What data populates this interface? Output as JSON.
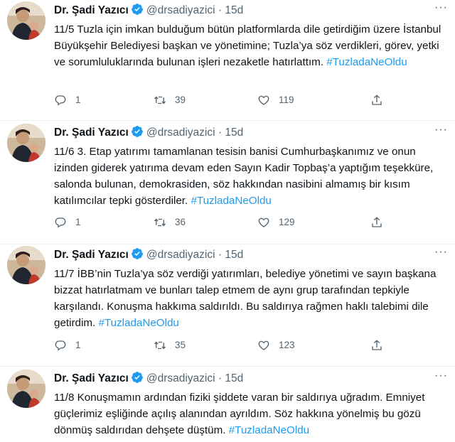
{
  "tweets": [
    {
      "name": "Dr. Şadi Yazıcı",
      "handle": "@drsadiyazici",
      "separator": "·",
      "time": "15d",
      "text": "11/5 Tuzla için imkan bulduğum bütün platformlarda dile getirdiğim üzere İstanbul Büyükşehir Belediyesi başkan ve yönetimine; Tuzla’ya söz verdikleri, görev, yetki ve sorumluluklarında bulunan işleri nezaketle hatırlattım. ",
      "hashtag": "#TuzladaNeOldu",
      "replies": "1",
      "retweets": "39",
      "likes": "119"
    },
    {
      "name": "Dr. Şadi Yazıcı",
      "handle": "@drsadiyazici",
      "separator": "·",
      "time": "15d",
      "text": "11/6 3. Etap yatırımı tamamlanan tesisin banisi Cumhurbaşkanımız ve onun izinden giderek yatırıma devam eden Sayın Kadir Topbaş’a yaptığım teşekküre, salonda bulunan, demokrasiden, söz hakkından nasibini almamış bir kısım katılımcılar tepki gösterdiler. ",
      "hashtag": "#TuzladaNeOldu",
      "replies": "1",
      "retweets": "36",
      "likes": "129"
    },
    {
      "name": "Dr. Şadi Yazıcı",
      "handle": "@drsadiyazici",
      "separator": "·",
      "time": "15d",
      "text": "11/7 İBB’nin Tuzla’ya söz verdiği yatırımları, belediye yönetimi ve sayın başkana bizzat hatırlatmam ve bunları talep etmem de aynı grup tarafından tepkiyle karşılandı. Konuşma hakkıma saldırıldı. Bu saldırıya rağmen haklı talebimi dile getirdim. ",
      "hashtag": "#TuzladaNeOldu",
      "replies": "1",
      "retweets": "35",
      "likes": "123"
    },
    {
      "name": "Dr. Şadi Yazıcı",
      "handle": "@drsadiyazici",
      "separator": "·",
      "time": "15d",
      "text": "11/8 Konuşmamın ardından fiziki şiddete varan bir saldırıya uğradım. Emniyet güçlerimiz eşliğinde açılış alanından ayrıldım. Söz hakkına yönelmiş bu gözü dönmüş saldırıdan dehşete düştüm. ",
      "hashtag": "#TuzladaNeOldu"
    }
  ],
  "icons": {
    "verified": "verified-badge-icon",
    "reply": "reply-icon",
    "retweet": "retweet-icon",
    "like": "heart-icon",
    "share": "share-icon",
    "more": "more-icon"
  },
  "colors": {
    "link": "#1d9bf0",
    "secondary_text": "#536471",
    "verified": "#1d9bf0"
  }
}
